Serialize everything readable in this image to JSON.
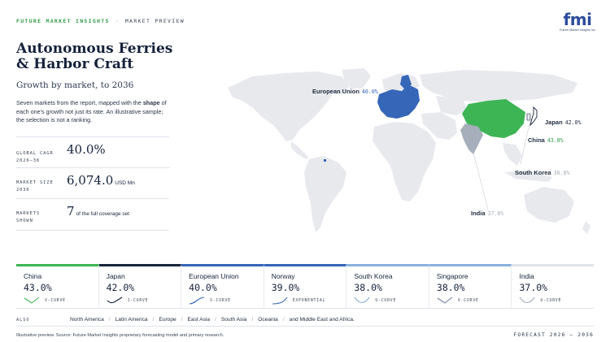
{
  "header": {
    "brand": "FUTURE MARKET INSIGHTS",
    "separator": "·",
    "section": "MARKET PREVIEW",
    "logo_mark": "fmi",
    "logo_sub": "Future Market Insights Inc."
  },
  "title": "Autonomous Ferries & Harbor Craft",
  "subtitle": "Growth by market, to 2036",
  "intro": {
    "before": "Seven markets from the report, mapped with the ",
    "bold": "shape",
    "after": " of each one's growth not just its rate. An illustrative sample; the selection is not a ranking."
  },
  "stats": [
    {
      "label_1": "GLOBAL CAGR",
      "label_2": "2026–36",
      "value": "40.0%",
      "unit": ""
    },
    {
      "label_1": "MARKET SIZE",
      "label_2": "2036",
      "value": "6,074.0",
      "unit": "USD Mn"
    },
    {
      "label_1": "MARKETS",
      "label_2": "SHOWN",
      "value": "7",
      "unit": "of the full coverage set"
    }
  ],
  "map_labels": {
    "eu": {
      "name": "European Union",
      "value": "40.0%"
    },
    "japan": {
      "name": "Japan",
      "value": "42.0%"
    },
    "china": {
      "name": "China",
      "value": "43.8%"
    },
    "south_korea": {
      "name": "South Korea",
      "value": "38.0%"
    },
    "india": {
      "name": "India",
      "value": "37.0%"
    }
  },
  "colors": {
    "green": "#3db555",
    "blue": "#3566b8",
    "india_gray": "#a6aebb",
    "land": "#e7e9ed",
    "card_accent": "#2f4f9c"
  },
  "cards": [
    {
      "name": "China",
      "cagr": "43.0%",
      "shape": "V-CURVE",
      "icon": "v-curve-icon"
    },
    {
      "name": "Japan",
      "cagr": "42.0%",
      "shape": "J-CURVE",
      "icon": "j-curve-icon"
    },
    {
      "name": "European Union",
      "cagr": "40.0%",
      "shape": "S-CURVE",
      "icon": "s-curve-icon"
    },
    {
      "name": "Norway",
      "cagr": "39.0%",
      "shape": "EXPONENTIAL",
      "icon": "exponential-curve-icon"
    },
    {
      "name": "South Korea",
      "cagr": "38.0%",
      "shape": "U-CURVE",
      "icon": "u-curve-icon"
    },
    {
      "name": "Singapore",
      "cagr": "38.0%",
      "shape": "V-CURVE",
      "icon": "v-curve-icon"
    },
    {
      "name": "India",
      "cagr": "37.0%",
      "shape": "U-CURVE",
      "icon": "u-curve-icon"
    }
  ],
  "also": {
    "label": "ALSO",
    "regions": [
      "North America",
      "Latin America",
      "Europe",
      "East Asia",
      "South Asia",
      "Oceania",
      "and Middle East and Africa."
    ]
  },
  "footer": {
    "note": "Illustrative preview. Source: Future Market Insights proprietary forecasting model and primary research.",
    "forecast": "FORECAST 2026 – 2036"
  }
}
